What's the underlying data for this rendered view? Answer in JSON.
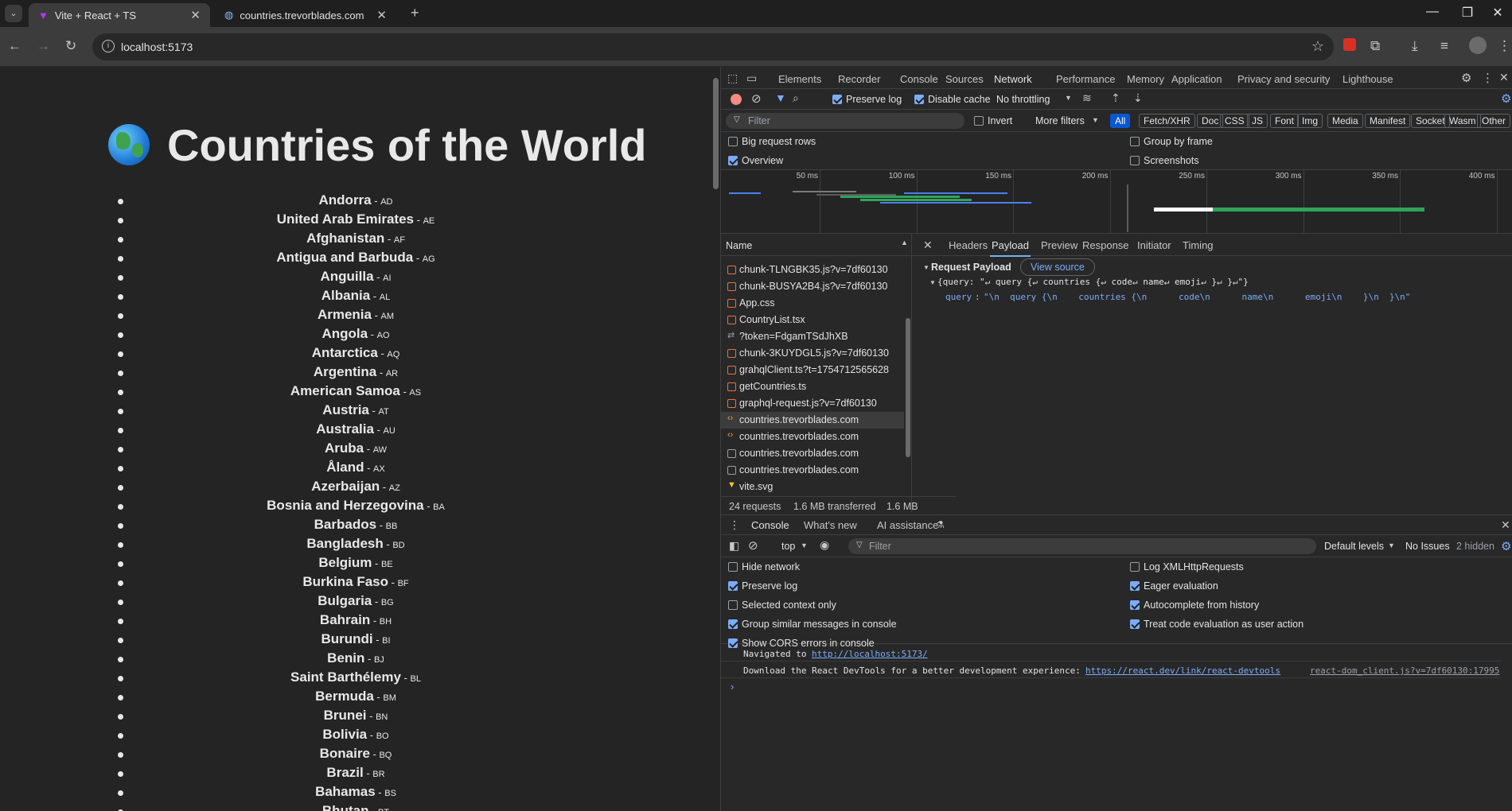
{
  "browser": {
    "tabs": [
      {
        "title": "Vite + React + TS",
        "active": true
      },
      {
        "title": "countries.trevorblades.com",
        "active": false
      }
    ],
    "url": "localhost:5173"
  },
  "page": {
    "title": "Countries of the World",
    "countries": [
      {
        "name": "Andorra",
        "code": "AD"
      },
      {
        "name": "United Arab Emirates",
        "code": "AE"
      },
      {
        "name": "Afghanistan",
        "code": "AF"
      },
      {
        "name": "Antigua and Barbuda",
        "code": "AG"
      },
      {
        "name": "Anguilla",
        "code": "AI"
      },
      {
        "name": "Albania",
        "code": "AL"
      },
      {
        "name": "Armenia",
        "code": "AM"
      },
      {
        "name": "Angola",
        "code": "AO"
      },
      {
        "name": "Antarctica",
        "code": "AQ"
      },
      {
        "name": "Argentina",
        "code": "AR"
      },
      {
        "name": "American Samoa",
        "code": "AS"
      },
      {
        "name": "Austria",
        "code": "AT"
      },
      {
        "name": "Australia",
        "code": "AU"
      },
      {
        "name": "Aruba",
        "code": "AW"
      },
      {
        "name": "Åland",
        "code": "AX"
      },
      {
        "name": "Azerbaijan",
        "code": "AZ"
      },
      {
        "name": "Bosnia and Herzegovina",
        "code": "BA"
      },
      {
        "name": "Barbados",
        "code": "BB"
      },
      {
        "name": "Bangladesh",
        "code": "BD"
      },
      {
        "name": "Belgium",
        "code": "BE"
      },
      {
        "name": "Burkina Faso",
        "code": "BF"
      },
      {
        "name": "Bulgaria",
        "code": "BG"
      },
      {
        "name": "Bahrain",
        "code": "BH"
      },
      {
        "name": "Burundi",
        "code": "BI"
      },
      {
        "name": "Benin",
        "code": "BJ"
      },
      {
        "name": "Saint Barthélemy",
        "code": "BL"
      },
      {
        "name": "Bermuda",
        "code": "BM"
      },
      {
        "name": "Brunei",
        "code": "BN"
      },
      {
        "name": "Bolivia",
        "code": "BO"
      },
      {
        "name": "Bonaire",
        "code": "BQ"
      },
      {
        "name": "Brazil",
        "code": "BR"
      },
      {
        "name": "Bahamas",
        "code": "BS"
      },
      {
        "name": "Bhutan",
        "code": "BT"
      }
    ]
  },
  "devtools": {
    "main_tabs": [
      "Elements",
      "Recorder",
      "Console",
      "Sources",
      "Network",
      "Performance",
      "Memory",
      "Application",
      "Privacy and security",
      "Lighthouse"
    ],
    "active_tab": "Network",
    "network": {
      "preserve_log": "Preserve log",
      "disable_cache": "Disable cache",
      "throttling": "No throttling",
      "filter_placeholder": "Filter",
      "invert": "Invert",
      "more_filters": "More filters",
      "type_filters": [
        "All",
        "Fetch/XHR",
        "Doc",
        "CSS",
        "JS",
        "Font",
        "Img",
        "Media",
        "Manifest",
        "Socket",
        "Wasm",
        "Other"
      ],
      "options_left": [
        {
          "label": "Big request rows",
          "checked": false
        },
        {
          "label": "Overview",
          "checked": true
        }
      ],
      "options_right": [
        {
          "label": "Group by frame",
          "checked": false
        },
        {
          "label": "Screenshots",
          "checked": false
        }
      ],
      "timeline_ticks": [
        "50 ms",
        "100 ms",
        "150 ms",
        "200 ms",
        "250 ms",
        "300 ms",
        "350 ms",
        "400 ms"
      ],
      "name_header": "Name",
      "requests": [
        {
          "name": "chunk-TLNGBK35.js?v=7df60130",
          "type": "script"
        },
        {
          "name": "chunk-BUSYA2B4.js?v=7df60130",
          "type": "script"
        },
        {
          "name": "App.css",
          "type": "script"
        },
        {
          "name": "CountryList.tsx",
          "type": "script"
        },
        {
          "name": "?token=FdgamTSdJhXB",
          "type": "ws"
        },
        {
          "name": "chunk-3KUYDGL5.js?v=7df60130",
          "type": "script"
        },
        {
          "name": "grahqlClient.ts?t=1754712565628",
          "type": "script"
        },
        {
          "name": "getCountries.ts",
          "type": "script"
        },
        {
          "name": "graphql-request.js?v=7df60130",
          "type": "script"
        },
        {
          "name": "countries.trevorblades.com",
          "type": "gql",
          "selected": true
        },
        {
          "name": "countries.trevorblades.com",
          "type": "gql"
        },
        {
          "name": "countries.trevorblades.com",
          "type": "doc"
        },
        {
          "name": "countries.trevorblades.com",
          "type": "doc"
        },
        {
          "name": "vite.svg",
          "type": "img"
        }
      ],
      "summary": {
        "requests": "24 requests",
        "transferred": "1.6 MB transferred",
        "resources": "1.6 MB"
      },
      "detail_tabs": [
        "Headers",
        "Payload",
        "Preview",
        "Response",
        "Initiator",
        "Timing"
      ],
      "active_detail_tab": "Payload",
      "payload": {
        "section_title": "Request Payload",
        "view_source": "View source",
        "summary_line": "{query: \"↵ query {↵ countries {↵ code↵ name↵ emoji↵ }↵ }↵\"}",
        "query_key": "query",
        "query_value": "\"\\n  query {\\n    countries {\\n      code\\n      name\\n      emoji\\n    }\\n  }\\n\""
      }
    },
    "drawer": {
      "tabs": [
        "Console",
        "What's new",
        "AI assistance"
      ],
      "active_tab": "Console",
      "context": "top",
      "filter_placeholder": "Filter",
      "levels": "Default levels",
      "issues": "No Issues",
      "hidden": "2 hidden",
      "settings_left": [
        {
          "label": "Hide network",
          "checked": false
        },
        {
          "label": "Preserve log",
          "checked": true
        },
        {
          "label": "Selected context only",
          "checked": false
        },
        {
          "label": "Group similar messages in console",
          "checked": true
        },
        {
          "label": "Show CORS errors in console",
          "checked": true
        }
      ],
      "settings_right": [
        {
          "label": "Log XMLHttpRequests",
          "checked": false
        },
        {
          "label": "Eager evaluation",
          "checked": true
        },
        {
          "label": "Autocomplete from history",
          "checked": true
        },
        {
          "label": "Treat code evaluation as user action",
          "checked": true
        }
      ],
      "messages": {
        "nav_prefix": "Navigated to",
        "nav_link": "http://localhost:5173/",
        "devtools_msg": "Download the React DevTools for a better development experience:",
        "devtools_link": "https://react.dev/link/react-devtools",
        "source_link": "react-dom_client.js?v=7df60130:17995"
      }
    }
  }
}
